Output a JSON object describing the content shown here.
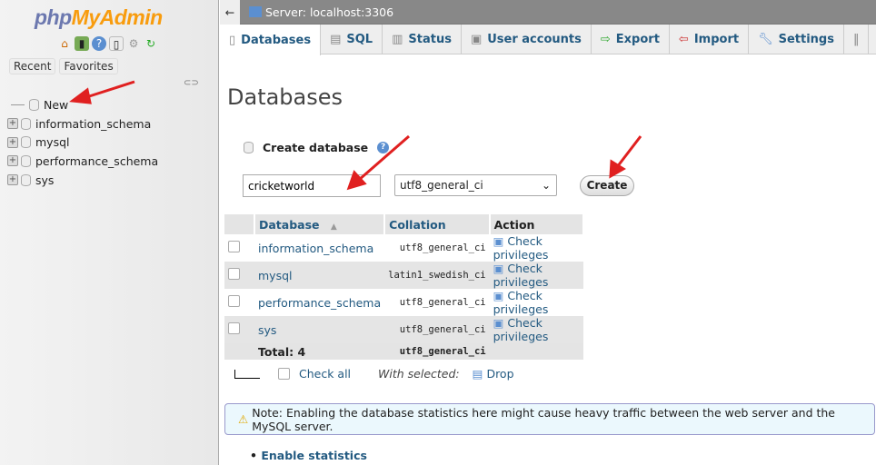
{
  "sidebar": {
    "logo_php": "php",
    "logo_my": "MyAdmin",
    "tabs": [
      "Recent",
      "Favorites"
    ],
    "tree": [
      {
        "label": "New"
      },
      {
        "label": "information_schema"
      },
      {
        "label": "mysql"
      },
      {
        "label": "performance_schema"
      },
      {
        "label": "sys"
      }
    ]
  },
  "topbar": {
    "back": "←",
    "server": "Server: localhost:3306"
  },
  "tabs": [
    {
      "label": "Databases",
      "active": true
    },
    {
      "label": "SQL"
    },
    {
      "label": "Status"
    },
    {
      "label": "User accounts"
    },
    {
      "label": "Export"
    },
    {
      "label": "Import"
    },
    {
      "label": "Settings"
    }
  ],
  "main": {
    "title": "Databases",
    "create_label": "Create database",
    "db_name": "cricketworld",
    "collation": "utf8_general_ci",
    "create_button": "Create",
    "headers": [
      "Database",
      "Collation",
      "Action"
    ],
    "rows": [
      {
        "name": "information_schema",
        "collation": "utf8_general_ci",
        "action": "Check privileges"
      },
      {
        "name": "mysql",
        "collation": "latin1_swedish_ci",
        "action": "Check privileges"
      },
      {
        "name": "performance_schema",
        "collation": "utf8_general_ci",
        "action": "Check privileges"
      },
      {
        "name": "sys",
        "collation": "utf8_general_ci",
        "action": "Check privileges"
      }
    ],
    "total": "Total: 4",
    "total_collation": "utf8_general_ci",
    "check_all": "Check all",
    "with_selected": "With selected:",
    "drop": "Drop",
    "notice": "Note: Enabling the database statistics here might cause heavy traffic between the web server and the MySQL server.",
    "enable_stats": "Enable statistics"
  },
  "colors": {
    "link": "#235a81",
    "accent_arrow": "#e02020"
  }
}
